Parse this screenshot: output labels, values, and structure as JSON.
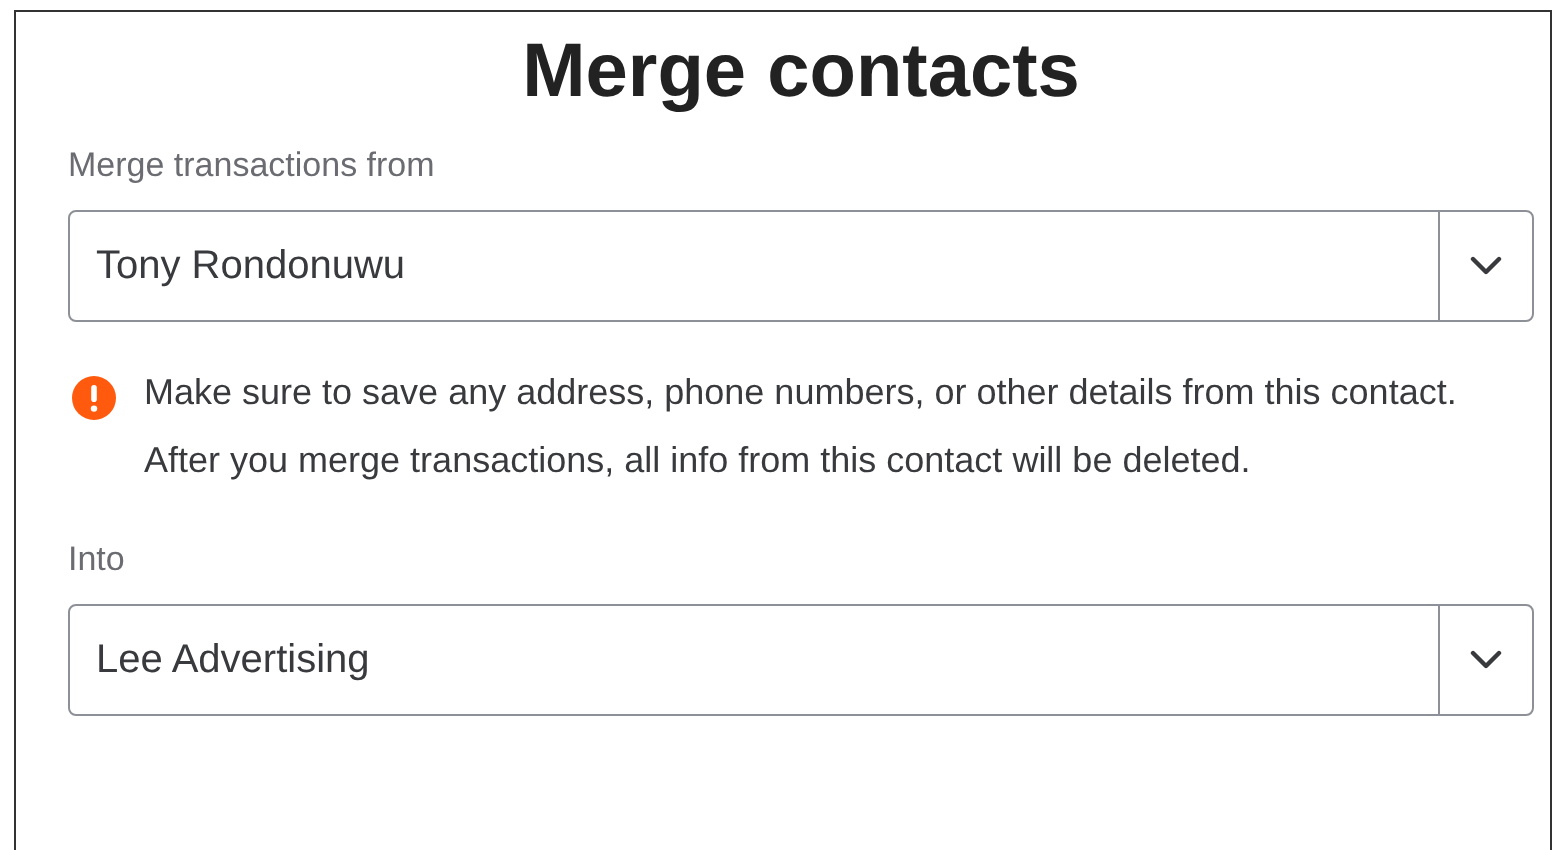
{
  "title": "Merge contacts",
  "fields": [
    {
      "label": "Merge transactions from",
      "value": "Tony Rondonuwu"
    },
    {
      "label": "Into",
      "value": "Lee Advertising"
    }
  ],
  "warning": {
    "text": "Make sure to save any address, phone numbers, or other details from this contact. After you merge transactions, all info from this contact will be deleted."
  }
}
